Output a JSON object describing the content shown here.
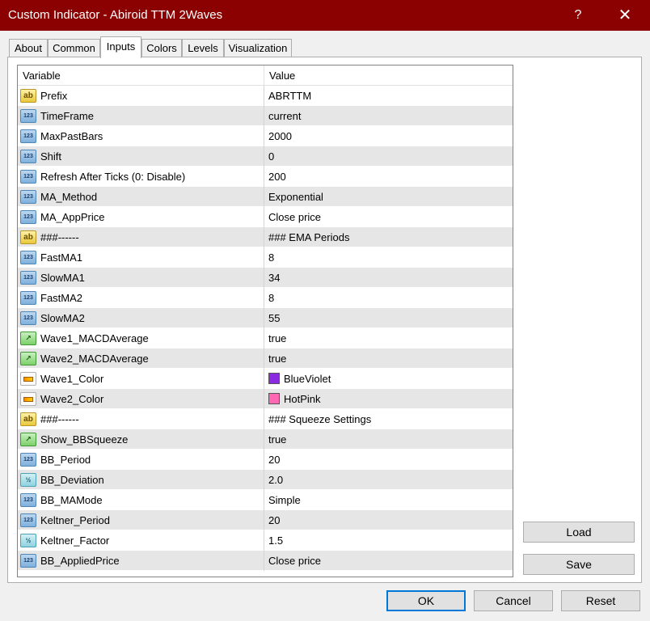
{
  "window": {
    "title": "Custom Indicator - Abiroid TTM 2Waves",
    "help": "?",
    "close": "✕"
  },
  "tabs": [
    {
      "label": "About"
    },
    {
      "label": "Common"
    },
    {
      "label": "Inputs"
    },
    {
      "label": "Colors"
    },
    {
      "label": "Levels"
    },
    {
      "label": "Visualization"
    }
  ],
  "active_tab": "Inputs",
  "grid": {
    "headers": {
      "variable": "Variable",
      "value": "Value"
    },
    "rows": [
      {
        "type": "string",
        "name": "Prefix",
        "value": "ABRTTM"
      },
      {
        "type": "int",
        "name": "TimeFrame",
        "value": "current"
      },
      {
        "type": "int",
        "name": "MaxPastBars",
        "value": "2000"
      },
      {
        "type": "int",
        "name": "Shift",
        "value": "0"
      },
      {
        "type": "int",
        "name": "Refresh After Ticks (0: Disable)",
        "value": "200"
      },
      {
        "type": "int",
        "name": "MA_Method",
        "value": "Exponential"
      },
      {
        "type": "int",
        "name": "MA_AppPrice",
        "value": "Close price"
      },
      {
        "type": "string",
        "name": "###------",
        "value": "### EMA Periods"
      },
      {
        "type": "int",
        "name": "FastMA1",
        "value": "8"
      },
      {
        "type": "int",
        "name": "SlowMA1",
        "value": "34"
      },
      {
        "type": "int",
        "name": "FastMA2",
        "value": "8"
      },
      {
        "type": "int",
        "name": "SlowMA2",
        "value": "55"
      },
      {
        "type": "bool",
        "name": "Wave1_MACDAverage",
        "value": "true"
      },
      {
        "type": "bool",
        "name": "Wave2_MACDAverage",
        "value": "true"
      },
      {
        "type": "color",
        "name": "Wave1_Color",
        "value": "BlueViolet",
        "swatch": "#8a2be2"
      },
      {
        "type": "color",
        "name": "Wave2_Color",
        "value": "HotPink",
        "swatch": "#ff69b4"
      },
      {
        "type": "string",
        "name": "###------",
        "value": "### Squeeze Settings"
      },
      {
        "type": "bool",
        "name": "Show_BBSqueeze",
        "value": "true"
      },
      {
        "type": "int",
        "name": "BB_Period",
        "value": "20"
      },
      {
        "type": "double",
        "name": "BB_Deviation",
        "value": "2.0"
      },
      {
        "type": "int",
        "name": "BB_MAMode",
        "value": "Simple"
      },
      {
        "type": "int",
        "name": "Keltner_Period",
        "value": "20"
      },
      {
        "type": "double",
        "name": "Keltner_Factor",
        "value": "1.5"
      },
      {
        "type": "int",
        "name": "BB_AppliedPrice",
        "value": "Close price"
      }
    ]
  },
  "icons": {
    "string": {
      "name": "string-type-icon",
      "glyph": "ab"
    },
    "int": {
      "name": "integer-type-icon",
      "glyph": "123"
    },
    "bool": {
      "name": "boolean-type-icon",
      "glyph": "↗"
    },
    "color": {
      "name": "color-type-icon",
      "glyph": ""
    },
    "double": {
      "name": "double-type-icon",
      "glyph": "½"
    }
  },
  "buttons": {
    "load": "Load",
    "save": "Save",
    "ok": "OK",
    "cancel": "Cancel",
    "reset": "Reset"
  },
  "colors": {
    "titlebar": "#8b0000",
    "default_button_border": "#0078d7"
  }
}
